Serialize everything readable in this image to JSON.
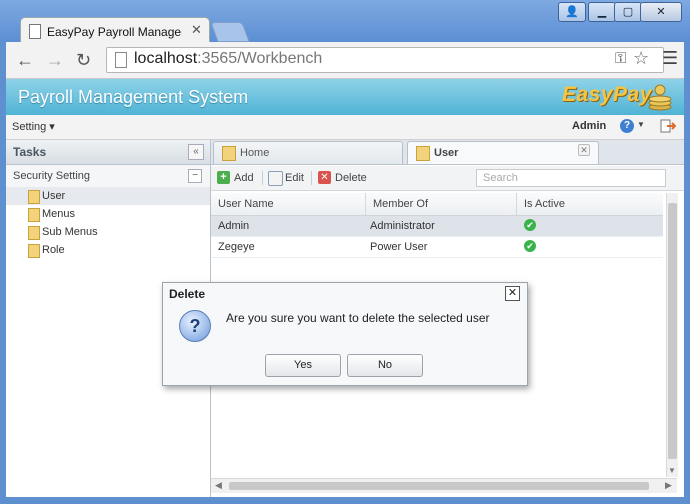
{
  "browser": {
    "tab_title": "EasyPay Payroll Managemen",
    "url_host": "localhost",
    "url_path": ":3565/Workbench"
  },
  "app": {
    "title": "Payroll Management System",
    "brand": "EasyPay",
    "setting_menu": "Setting",
    "user": "Admin"
  },
  "left_panel": {
    "title": "Tasks",
    "section": "Security Setting",
    "items": [
      {
        "label": "User"
      },
      {
        "label": "Menus"
      },
      {
        "label": "Sub Menus"
      },
      {
        "label": "Role"
      }
    ]
  },
  "tabs": [
    {
      "label": "Home"
    },
    {
      "label": "User"
    }
  ],
  "toolbar": {
    "add": "Add",
    "edit": "Edit",
    "delete": "Delete",
    "search_placeholder": "Search"
  },
  "grid": {
    "columns": [
      "User Name",
      "Member Of",
      "Is Active"
    ],
    "rows": [
      {
        "user_name": "Admin",
        "member_of": "Administrator",
        "is_active": "✔"
      },
      {
        "user_name": "Zegeye",
        "member_of": "Power User",
        "is_active": "✔"
      }
    ]
  },
  "dialog": {
    "title": "Delete",
    "message": "Are you sure you want to delete the selected user",
    "yes": "Yes",
    "no": "No"
  }
}
